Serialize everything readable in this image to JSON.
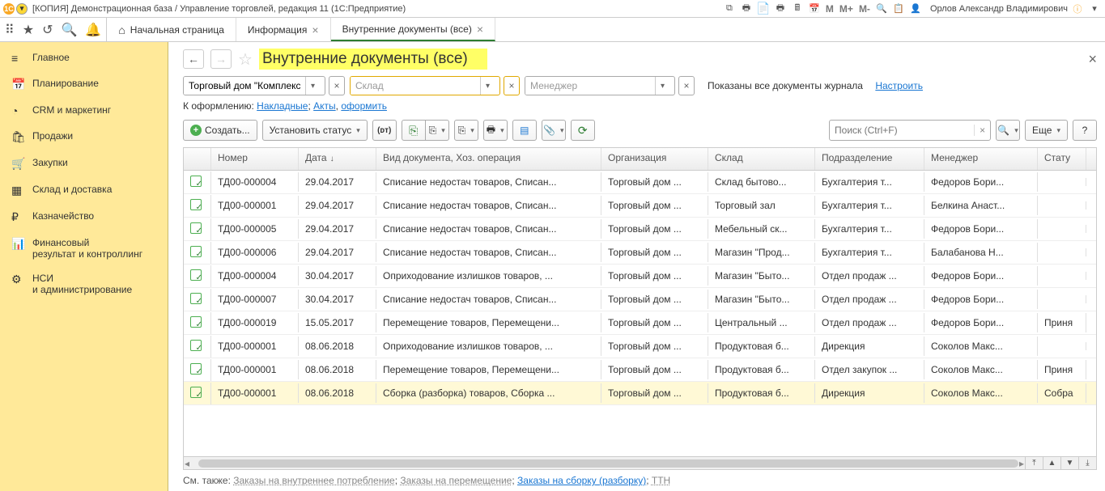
{
  "titlebar": {
    "app_title": "[КОПИЯ] Демонстрационная база / Управление торговлей, редакция 11  (1С:Предприятие)",
    "m_labels": [
      "M",
      "M+",
      "M-"
    ],
    "user": "Орлов Александр Владимирович"
  },
  "tabs": {
    "home": "Начальная страница",
    "items": [
      {
        "label": "Информация",
        "active": false
      },
      {
        "label": "Внутренние документы (все)",
        "active": true
      }
    ]
  },
  "sidebar": [
    {
      "icon": "≡",
      "label": "Главное"
    },
    {
      "icon": "📅",
      "label": "Планирование"
    },
    {
      "icon": "◔",
      "label": "CRM и маркетинг"
    },
    {
      "icon": "🛍",
      "label": "Продажи"
    },
    {
      "icon": "🛒",
      "label": "Закупки"
    },
    {
      "icon": "▦",
      "label": "Склад и доставка"
    },
    {
      "icon": "₽",
      "label": "Казначейство"
    },
    {
      "icon": "📊",
      "label": "Финансовый\nрезультат и контроллинг"
    },
    {
      "icon": "⚙",
      "label": "НСИ\nи администрирование"
    }
  ],
  "page": {
    "title": "Внутренние документы (все)"
  },
  "filters": {
    "org_value": "Торговый дом \"Комплексн",
    "warehouse_placeholder": "Склад",
    "manager_placeholder": "Менеджер",
    "info": "Показаны все документы журнала",
    "configure": "Настроить"
  },
  "format_line": {
    "prefix": "К оформлению: ",
    "links": [
      "Накладные",
      "Акты",
      "оформить"
    ]
  },
  "toolbar": {
    "create": "Создать...",
    "status": "Установить статус",
    "search_placeholder": "Поиск (Ctrl+F)",
    "more": "Еще",
    "help": "?"
  },
  "grid": {
    "headers": [
      "",
      "Номер",
      "Дата",
      "Вид документа, Хоз. операция",
      "Организация",
      "Склад",
      "Подразделение",
      "Менеджер",
      "Стату"
    ],
    "rows": [
      {
        "num": "ТД00-000004",
        "date": "29.04.2017",
        "kind": "Списание недостач товаров, Списан...",
        "org": "Торговый дом ...",
        "wh": "Склад бытово...",
        "dep": "Бухгалтерия т...",
        "mgr": "Федоров Бори...",
        "st": ""
      },
      {
        "num": "ТД00-000001",
        "date": "29.04.2017",
        "kind": "Списание недостач товаров, Списан...",
        "org": "Торговый дом ...",
        "wh": "Торговый зал",
        "dep": "Бухгалтерия т...",
        "mgr": "Белкина Анаст...",
        "st": ""
      },
      {
        "num": "ТД00-000005",
        "date": "29.04.2017",
        "kind": "Списание недостач товаров, Списан...",
        "org": "Торговый дом ...",
        "wh": "Мебельный ск...",
        "dep": "Бухгалтерия т...",
        "mgr": "Федоров Бори...",
        "st": ""
      },
      {
        "num": "ТД00-000006",
        "date": "29.04.2017",
        "kind": "Списание недостач товаров, Списан...",
        "org": "Торговый дом ...",
        "wh": "Магазин \"Прод...",
        "dep": "Бухгалтерия т...",
        "mgr": "Балабанова Н...",
        "st": ""
      },
      {
        "num": "ТД00-000004",
        "date": "30.04.2017",
        "kind": "Оприходование излишков товаров, ...",
        "org": "Торговый дом ...",
        "wh": "Магазин \"Быто...",
        "dep": "Отдел продаж ...",
        "mgr": "Федоров Бори...",
        "st": ""
      },
      {
        "num": "ТД00-000007",
        "date": "30.04.2017",
        "kind": "Списание недостач товаров, Списан...",
        "org": "Торговый дом ...",
        "wh": "Магазин \"Быто...",
        "dep": "Отдел продаж ...",
        "mgr": "Федоров Бори...",
        "st": ""
      },
      {
        "num": "ТД00-000019",
        "date": "15.05.2017",
        "kind": "Перемещение товаров, Перемещени...",
        "org": "Торговый дом ...",
        "wh": "Центральный ...",
        "dep": "Отдел продаж ...",
        "mgr": "Федоров Бори...",
        "st": "Приня"
      },
      {
        "num": "ТД00-000001",
        "date": "08.06.2018",
        "kind": "Оприходование излишков товаров, ...",
        "org": "Торговый дом ...",
        "wh": "Продуктовая б...",
        "dep": "Дирекция",
        "mgr": "Соколов Макс...",
        "st": ""
      },
      {
        "num": "ТД00-000001",
        "date": "08.06.2018",
        "kind": "Перемещение товаров, Перемещени...",
        "org": "Торговый дом ...",
        "wh": "Продуктовая б...",
        "dep": "Отдел закупок ...",
        "mgr": "Соколов Макс...",
        "st": "Приня"
      },
      {
        "num": "ТД00-000001",
        "date": "08.06.2018",
        "kind": "Сборка (разборка) товаров, Сборка ...",
        "org": "Торговый дом ...",
        "wh": "Продуктовая б...",
        "dep": "Дирекция",
        "mgr": "Соколов Макс...",
        "st": "Собра",
        "sel": true
      }
    ]
  },
  "footer": {
    "prefix": "См. также: ",
    "links": [
      {
        "text": "Заказы на внутреннее потребление",
        "active": false
      },
      {
        "text": "Заказы на перемещение",
        "active": false
      },
      {
        "text": "Заказы на сборку (разборку)",
        "active": true
      },
      {
        "text": "ТТН",
        "active": false
      }
    ]
  }
}
